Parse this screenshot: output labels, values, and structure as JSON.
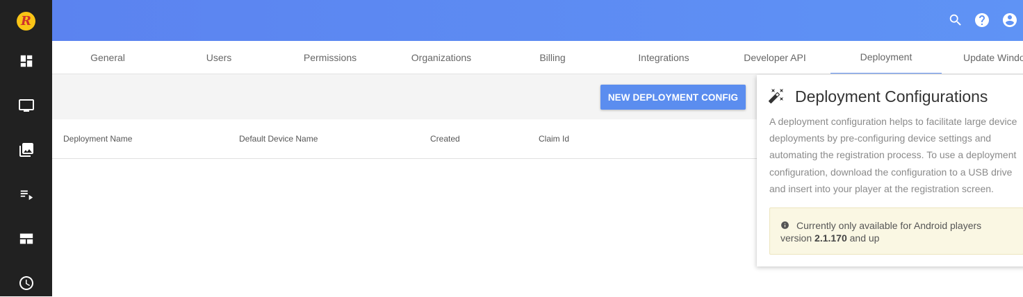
{
  "sidebar": {
    "logo_letter": "R",
    "items": [
      {
        "icon": "dashboard-icon"
      },
      {
        "icon": "monitor-icon"
      },
      {
        "icon": "media-library-icon"
      },
      {
        "icon": "playlist-icon"
      },
      {
        "icon": "layout-icon"
      },
      {
        "icon": "clock-icon"
      }
    ]
  },
  "topbar": {
    "icons": [
      "search-icon",
      "help-icon",
      "account-icon"
    ]
  },
  "tabs": [
    {
      "label": "General"
    },
    {
      "label": "Users"
    },
    {
      "label": "Permissions"
    },
    {
      "label": "Organizations"
    },
    {
      "label": "Billing"
    },
    {
      "label": "Integrations"
    },
    {
      "label": "Developer API"
    },
    {
      "label": "Deployment",
      "active": true
    },
    {
      "label": "Update Windo"
    }
  ],
  "toolbar": {
    "new_button_label": "NEW DEPLOYMENT CONFIG"
  },
  "table": {
    "columns": [
      "Deployment Name",
      "Default Device Name",
      "Created",
      "Claim Id"
    ],
    "rows": []
  },
  "panel": {
    "title": "Deployment Configurations",
    "description": "A deployment configuration helps to facilitate large device deployments by pre-configuring device settings and automating the registration process. To use a deployment configuration, download the configuration to a USB drive and insert into your player at the registration screen.",
    "notice_prefix": "Currently only available for Android players version ",
    "notice_version": "2.1.170",
    "notice_suffix": " and up"
  },
  "colors": {
    "accent": "#5b8def",
    "sidebar": "#212121",
    "notice_bg": "#faf7e3"
  }
}
